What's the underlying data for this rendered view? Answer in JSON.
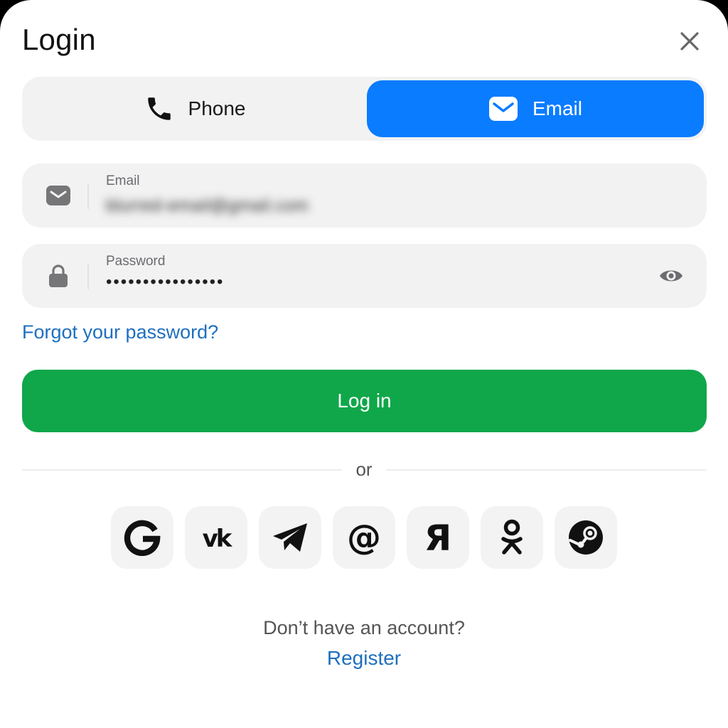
{
  "header": {
    "title": "Login"
  },
  "tabs": [
    {
      "label": "Phone",
      "icon": "phone-icon",
      "active": false
    },
    {
      "label": "Email",
      "icon": "mail-icon",
      "active": true
    }
  ],
  "email_field": {
    "label": "Email",
    "value": "blurred-email@gmail.com",
    "icon": "mail-icon"
  },
  "password_field": {
    "label": "Password",
    "value": "••••••••••••••••",
    "icon": "lock-icon",
    "toggle_icon": "eye-icon"
  },
  "forgot_link": "Forgot your password?",
  "login_button": "Log in",
  "divider_text": "or",
  "social_logins": [
    {
      "name": "Google",
      "icon": "google-icon"
    },
    {
      "name": "VK",
      "icon": "vk-icon"
    },
    {
      "name": "Telegram",
      "icon": "telegram-icon"
    },
    {
      "name": "Mail.ru",
      "icon": "at-icon"
    },
    {
      "name": "Yandex",
      "icon": "yandex-icon"
    },
    {
      "name": "Odnoklassniki",
      "icon": "ok-icon"
    },
    {
      "name": "Steam",
      "icon": "steam-icon"
    }
  ],
  "footer": {
    "prompt": "Don’t have an account?",
    "register_link": "Register"
  },
  "colors": {
    "accent_blue": "#0a7cff",
    "login_green": "#0fa74a",
    "link_blue": "#1e6fbf",
    "field_bg": "#f2f2f3"
  }
}
